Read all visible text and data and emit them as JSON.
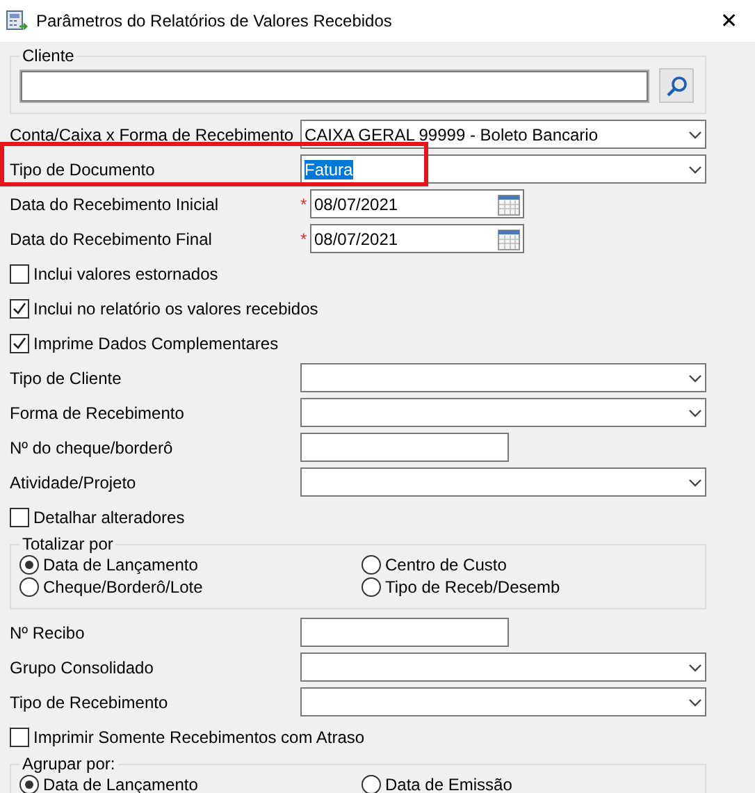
{
  "window": {
    "title": "Parâmetros do Relatórios de Valores Recebidos",
    "close": "✕"
  },
  "cliente": {
    "label": "Cliente"
  },
  "fields": [
    {
      "kind": "select",
      "label": "Conta/Caixa x Forma de Recebimento",
      "value": "CAIXA GERAL 99999 - Boleto Bancario",
      "highlighted": false
    },
    {
      "kind": "select",
      "label": "Tipo de Documento",
      "value": "Fatura",
      "text_selected": true,
      "highlighted": true
    },
    {
      "kind": "date",
      "label": "Data do Recebimento Inicial",
      "required_mark": "*",
      "value": "08/07/2021",
      "highlighted": false
    },
    {
      "kind": "date",
      "label": "Data do Recebimento Final",
      "required_mark": "*",
      "value": "08/07/2021",
      "highlighted": false
    },
    {
      "kind": "checkbox",
      "label": "Inclui valores estornados",
      "checked": false,
      "highlighted": false
    },
    {
      "kind": "checkbox",
      "label": "Inclui no relatório os valores recebidos",
      "checked": true,
      "highlighted": false
    },
    {
      "kind": "checkbox",
      "label": "Imprime Dados Complementares",
      "checked": true,
      "highlighted": false
    },
    {
      "kind": "select",
      "label": "Tipo de Cliente",
      "highlighted": false
    },
    {
      "kind": "select",
      "label": "Forma de Recebimento",
      "highlighted": false
    },
    {
      "kind": "text",
      "label": "Nº do cheque/borderô",
      "highlighted": false
    },
    {
      "kind": "select",
      "label": "Atividade/Projeto",
      "highlighted": false
    },
    {
      "kind": "checkbox",
      "label": "Detalhar alteradores",
      "checked": false,
      "highlighted": false
    },
    {
      "kind": "radio_group",
      "label": "Totalizar por",
      "options": [
        {
          "label": "Data de Lançamento",
          "selected": true
        },
        {
          "label": "Centro de Custo",
          "selected": false
        },
        {
          "label": "Cheque/Borderô/Lote",
          "selected": false
        },
        {
          "label": "Tipo de Receb/Desemb",
          "selected": false
        }
      ]
    },
    {
      "kind": "text",
      "label": "Nº Recibo",
      "highlighted": false
    },
    {
      "kind": "select",
      "label": "Grupo Consolidado",
      "highlighted": false
    },
    {
      "kind": "select",
      "label": "Tipo de Recebimento",
      "highlighted": false
    },
    {
      "kind": "checkbox",
      "label": "Imprimir Somente Recebimentos com Atraso",
      "checked": false,
      "highlighted": false
    },
    {
      "kind": "radio_group",
      "label": "Agrupar por:",
      "options": [
        {
          "label": "Data de Lançamento",
          "selected": true
        },
        {
          "label": "Data de Emissão",
          "selected": false
        }
      ]
    }
  ]
}
